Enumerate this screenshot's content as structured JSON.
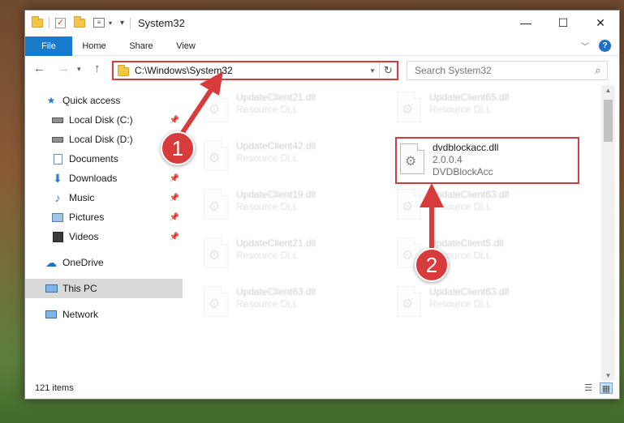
{
  "window": {
    "title": "System32",
    "controls": {
      "minimize": "—",
      "maximize": "☐",
      "close": "✕"
    }
  },
  "ribbon": {
    "tabs": [
      {
        "label": "File",
        "active": true
      },
      {
        "label": "Home"
      },
      {
        "label": "Share"
      },
      {
        "label": "View"
      }
    ]
  },
  "address": {
    "path": "C:\\Windows\\System32",
    "search_placeholder": "Search System32"
  },
  "sidebar": {
    "items": [
      {
        "label": "Quick access",
        "icon": "star-icon",
        "pinned": false
      },
      {
        "label": "Local Disk (C:)",
        "icon": "drive-icon",
        "pinned": true
      },
      {
        "label": "Local Disk (D:)",
        "icon": "drive-icon",
        "pinned": false
      },
      {
        "label": "Documents",
        "icon": "documents-icon",
        "pinned": true
      },
      {
        "label": "Downloads",
        "icon": "download-icon",
        "pinned": true
      },
      {
        "label": "Music",
        "icon": "music-icon",
        "pinned": true
      },
      {
        "label": "Pictures",
        "icon": "pictures-icon",
        "pinned": true
      },
      {
        "label": "Videos",
        "icon": "videos-icon",
        "pinned": true
      },
      {
        "label": "OneDrive",
        "icon": "cloud-icon",
        "pinned": false
      },
      {
        "label": "This PC",
        "icon": "pc-icon",
        "pinned": false,
        "selected": true
      },
      {
        "label": "Network",
        "icon": "network-icon",
        "pinned": false
      }
    ]
  },
  "files": [
    {
      "name": "UpdateClient21.dll",
      "sub": "Resource DLL"
    },
    {
      "name": "UpdateClient65.dll",
      "sub": "Resource DLL"
    },
    {
      "name": "UpdateClient42.dll",
      "sub": "Resource DLL"
    },
    {
      "name": "dvdblockacc.dll",
      "version": "2.0.0.4",
      "sub": "DVDBlockAcc",
      "highlighted": true
    },
    {
      "name": "UpdateClient19.dll",
      "sub": "Resource DLL"
    },
    {
      "name": "UpdateClient63.dll",
      "sub": "Resource DLL"
    },
    {
      "name": "UpdateClient21.dll",
      "sub": "Resource DLL"
    },
    {
      "name": "UpdateClient5.dll",
      "sub": "Resource DLL"
    },
    {
      "name": "UpdateClient63.dll",
      "sub": "Resource DLL"
    },
    {
      "name": "UpdateClient63.dll",
      "sub": "Resource DLL"
    }
  ],
  "status": {
    "item_count": "121 items"
  },
  "annotations": {
    "step1": "1",
    "step2": "2"
  },
  "colors": {
    "accent": "#1979ca",
    "annotation_red": "#d83b3b"
  }
}
